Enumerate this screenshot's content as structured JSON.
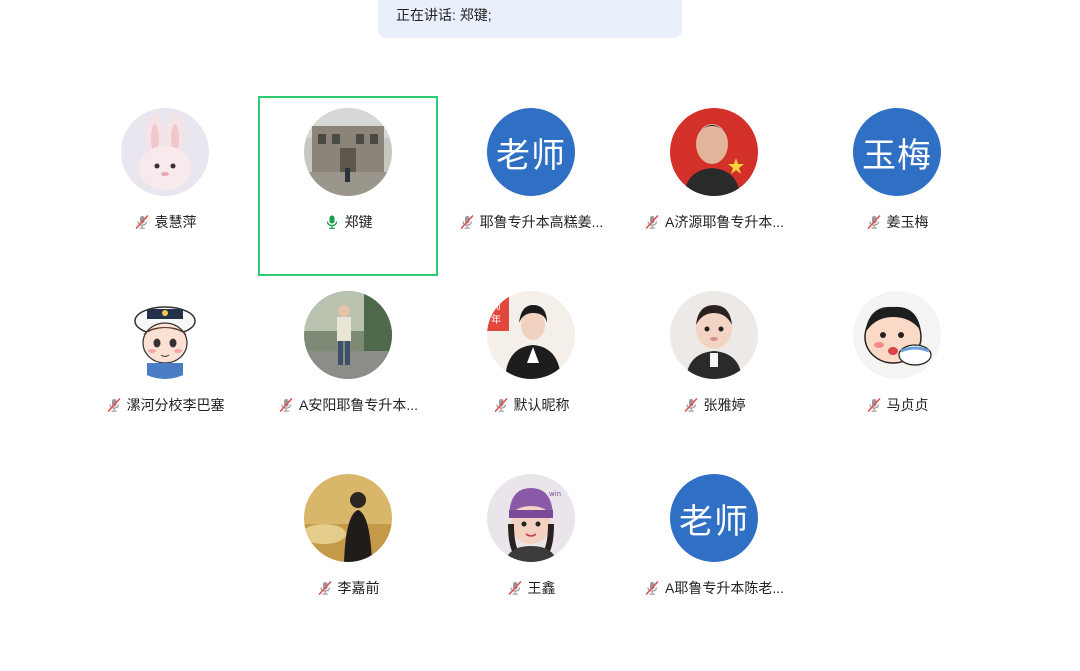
{
  "banner": {
    "text": "正在讲话: 郑键;"
  },
  "participants": [
    {
      "name": "袁慧萍",
      "mic": "muted",
      "avatar": {
        "type": "photo",
        "icon": "bunny-plush-photo"
      }
    },
    {
      "name": "郑键",
      "mic": "speaking",
      "avatar": {
        "type": "photo",
        "icon": "building-photo"
      },
      "active": true
    },
    {
      "name": "耶鲁专升本高糕姜...",
      "mic": "muted",
      "avatar": {
        "type": "text",
        "text": "老师"
      }
    },
    {
      "name": "A济源耶鲁专升本...",
      "mic": "muted",
      "avatar": {
        "type": "photo",
        "icon": "man-with-flag-photo"
      }
    },
    {
      "name": "姜玉梅",
      "mic": "muted",
      "avatar": {
        "type": "text",
        "text": "玉梅"
      }
    },
    {
      "name": "漯河分校李巴塞",
      "mic": "muted",
      "avatar": {
        "type": "photo",
        "icon": "cartoon-sailor-photo"
      }
    },
    {
      "name": "A安阳耶鲁专升本...",
      "mic": "muted",
      "avatar": {
        "type": "photo",
        "icon": "street-person-photo"
      }
    },
    {
      "name": "默认昵称",
      "mic": "muted",
      "avatar": {
        "type": "photo",
        "icon": "woman-suit-photo"
      }
    },
    {
      "name": "张雅婷",
      "mic": "muted",
      "avatar": {
        "type": "photo",
        "icon": "child-photo"
      }
    },
    {
      "name": "马贞贞",
      "mic": "muted",
      "avatar": {
        "type": "photo",
        "icon": "cartoon-eating-photo"
      }
    },
    {
      "name": "李嘉前",
      "mic": "muted",
      "avatar": {
        "type": "photo",
        "icon": "person-silhouette-photo"
      }
    },
    {
      "name": "王鑫",
      "mic": "muted",
      "avatar": {
        "type": "photo",
        "icon": "girl-purple-hat-photo"
      }
    },
    {
      "name": "A耶鲁专升本陈老...",
      "mic": "muted",
      "avatar": {
        "type": "text",
        "text": "老师"
      }
    }
  ],
  "colors": {
    "active_border": "#2ecc71",
    "text_avatar_bg": "#2f6fc4",
    "muted_mic": "#e05050",
    "speaking_mic": "#1e9e4a",
    "banner_bg": "#eaf0fb"
  }
}
